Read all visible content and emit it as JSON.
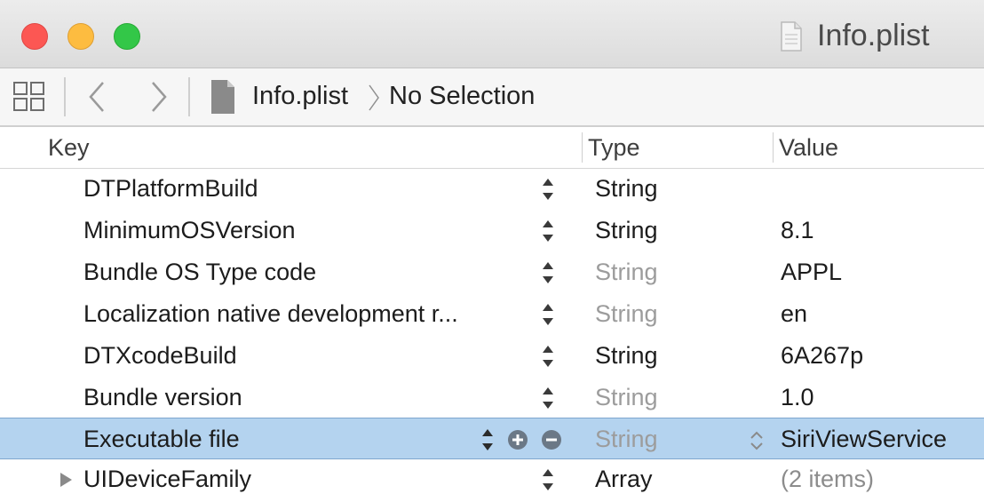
{
  "window": {
    "title": "Info.plist"
  },
  "nav": {
    "breadcrumb_file": "Info.plist",
    "breadcrumb_selection": "No Selection"
  },
  "table": {
    "columns": {
      "key": "Key",
      "type": "Type",
      "value": "Value"
    },
    "rows": [
      {
        "key": "DTPlatformBuild",
        "type": "String",
        "value": ""
      },
      {
        "key": "MinimumOSVersion",
        "type": "String",
        "value": "8.1"
      },
      {
        "key": "Bundle OS Type code",
        "type": "String",
        "value": "APPL"
      },
      {
        "key": "Localization native development r...",
        "type": "String",
        "value": "en"
      },
      {
        "key": "DTXcodeBuild",
        "type": "String",
        "value": "6A267p"
      },
      {
        "key": "Bundle version",
        "type": "String",
        "value": "1.0"
      },
      {
        "key": "Executable file",
        "type": "String",
        "value": "SiriViewService"
      },
      {
        "key": "UIDeviceFamily",
        "type": "Array",
        "value": "(2 items)"
      }
    ]
  },
  "icons": {
    "grid": "grid-view-icon",
    "back": "back-chevron-icon",
    "forward": "forward-chevron-icon",
    "file": "document-icon",
    "stepper": "up-down-stepper-icon",
    "add": "plus-circle-icon",
    "remove": "minus-circle-icon",
    "disclosure": "disclosure-triangle-icon"
  },
  "colors": {
    "close": "#fc5753",
    "minimize": "#fdbc40",
    "zoom": "#33c748",
    "selection": "#b4d3ef"
  }
}
